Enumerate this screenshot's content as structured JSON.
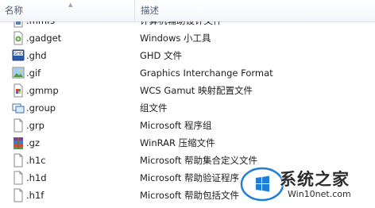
{
  "header": {
    "name_label": "名称",
    "desc_label": "描述"
  },
  "rows": [
    {
      "ext": ".mmfs",
      "desc": "计算机辅助设计文件",
      "icon": "generic-file-icon"
    },
    {
      "ext": ".gadget",
      "desc": "Windows 小工具",
      "icon": "gadget-icon"
    },
    {
      "ext": ".ghd",
      "desc": "GHD 文件",
      "icon": "ghd-icon"
    },
    {
      "ext": ".gif",
      "desc": "Graphics Interchange Format",
      "icon": "gif-image-icon"
    },
    {
      "ext": ".gmmp",
      "desc": "WCS Gamut 映射配置文件",
      "icon": "gmmp-icon"
    },
    {
      "ext": ".group",
      "desc": "组文件",
      "icon": "group-icon"
    },
    {
      "ext": ".grp",
      "desc": "Microsoft 程序组",
      "icon": "blank-file-icon"
    },
    {
      "ext": ".gz",
      "desc": "WinRAR 压缩文件",
      "icon": "winrar-archive-icon"
    },
    {
      "ext": ".h1c",
      "desc": "Microsoft 帮助集合定义文件",
      "icon": "blank-file-icon"
    },
    {
      "ext": ".h1d",
      "desc": "Microsoft 帮助验证程序",
      "icon": "blank-file-icon"
    },
    {
      "ext": ".h1f",
      "desc": "Microsoft 帮助包括文件",
      "icon": "blank-file-icon"
    }
  ],
  "watermark": {
    "title": "系统之家",
    "url": "Win10net.com"
  },
  "colors": {
    "header_text": "#4c607a",
    "watermark_blue": "#1e7fd4"
  }
}
